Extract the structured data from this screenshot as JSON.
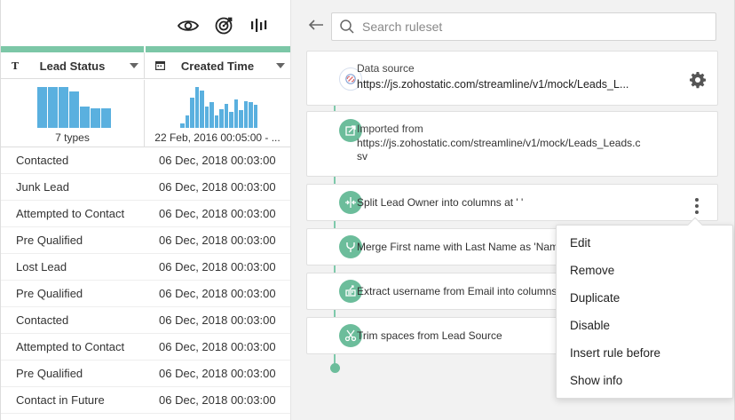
{
  "toolbar": {
    "icons": [
      "eye-icon",
      "target-icon",
      "waveform-icon"
    ]
  },
  "grid": {
    "columns": [
      {
        "type_glyph": "T",
        "label": "Lead Status",
        "summary": "7 types",
        "histogram": [
          0.95,
          0.95,
          0.95,
          0.85,
          0.5,
          0.46,
          0.46
        ]
      },
      {
        "label": "Created Time",
        "summary": "22 Feb, 2016 00:05:00 - ...",
        "histogram": [
          0.1,
          0.3,
          0.7,
          0.96,
          0.88,
          0.5,
          0.6,
          0.3,
          0.44,
          0.56,
          0.38,
          0.66,
          0.42,
          0.62,
          0.6,
          0.55
        ]
      }
    ],
    "rows": [
      {
        "status": "Contacted",
        "created": "06 Dec, 2018 00:03:00"
      },
      {
        "status": "Junk Lead",
        "created": "06 Dec, 2018 00:03:00"
      },
      {
        "status": "Attempted to Contact",
        "created": "06 Dec, 2018 00:03:00"
      },
      {
        "status": "Pre Qualified",
        "created": "06 Dec, 2018 00:03:00"
      },
      {
        "status": "Lost Lead",
        "created": "06 Dec, 2018 00:03:00"
      },
      {
        "status": "Pre Qualified",
        "created": "06 Dec, 2018 00:03:00"
      },
      {
        "status": "Contacted",
        "created": "06 Dec, 2018 00:03:00"
      },
      {
        "status": "Attempted to Contact",
        "created": "06 Dec, 2018 00:03:00"
      },
      {
        "status": "Pre Qualified",
        "created": "06 Dec, 2018 00:03:00"
      },
      {
        "status": "Contact in Future",
        "created": "06 Dec, 2018 00:03:00"
      }
    ]
  },
  "ruleset": {
    "search_placeholder": "Search ruleset",
    "data_source": {
      "label": "Data source",
      "url": "https://js.zohostatic.com/streamline/v1/mock/Leads_L..."
    },
    "imported": {
      "label": "Imported from",
      "line1": "https://js.zohostatic.com/streamline/v1/mock/Leads_Leads.c",
      "line2": "sv"
    },
    "rules": [
      {
        "text": "Split Lead Owner into columns at ' '",
        "icon": "split-icon"
      },
      {
        "text": "Merge First name with Last Name as 'Name",
        "icon": "merge-icon"
      },
      {
        "text": "Extract username from Email into columns '",
        "icon": "extract-icon"
      },
      {
        "text": "Trim spaces from Lead Source",
        "icon": "trim-icon"
      }
    ]
  },
  "context_menu": {
    "items": [
      "Edit",
      "Remove",
      "Duplicate",
      "Disable",
      "Insert rule before",
      "Show info"
    ]
  },
  "colors": {
    "accent_green": "#6cbd9b",
    "histogram_blue": "#5ab0df"
  }
}
